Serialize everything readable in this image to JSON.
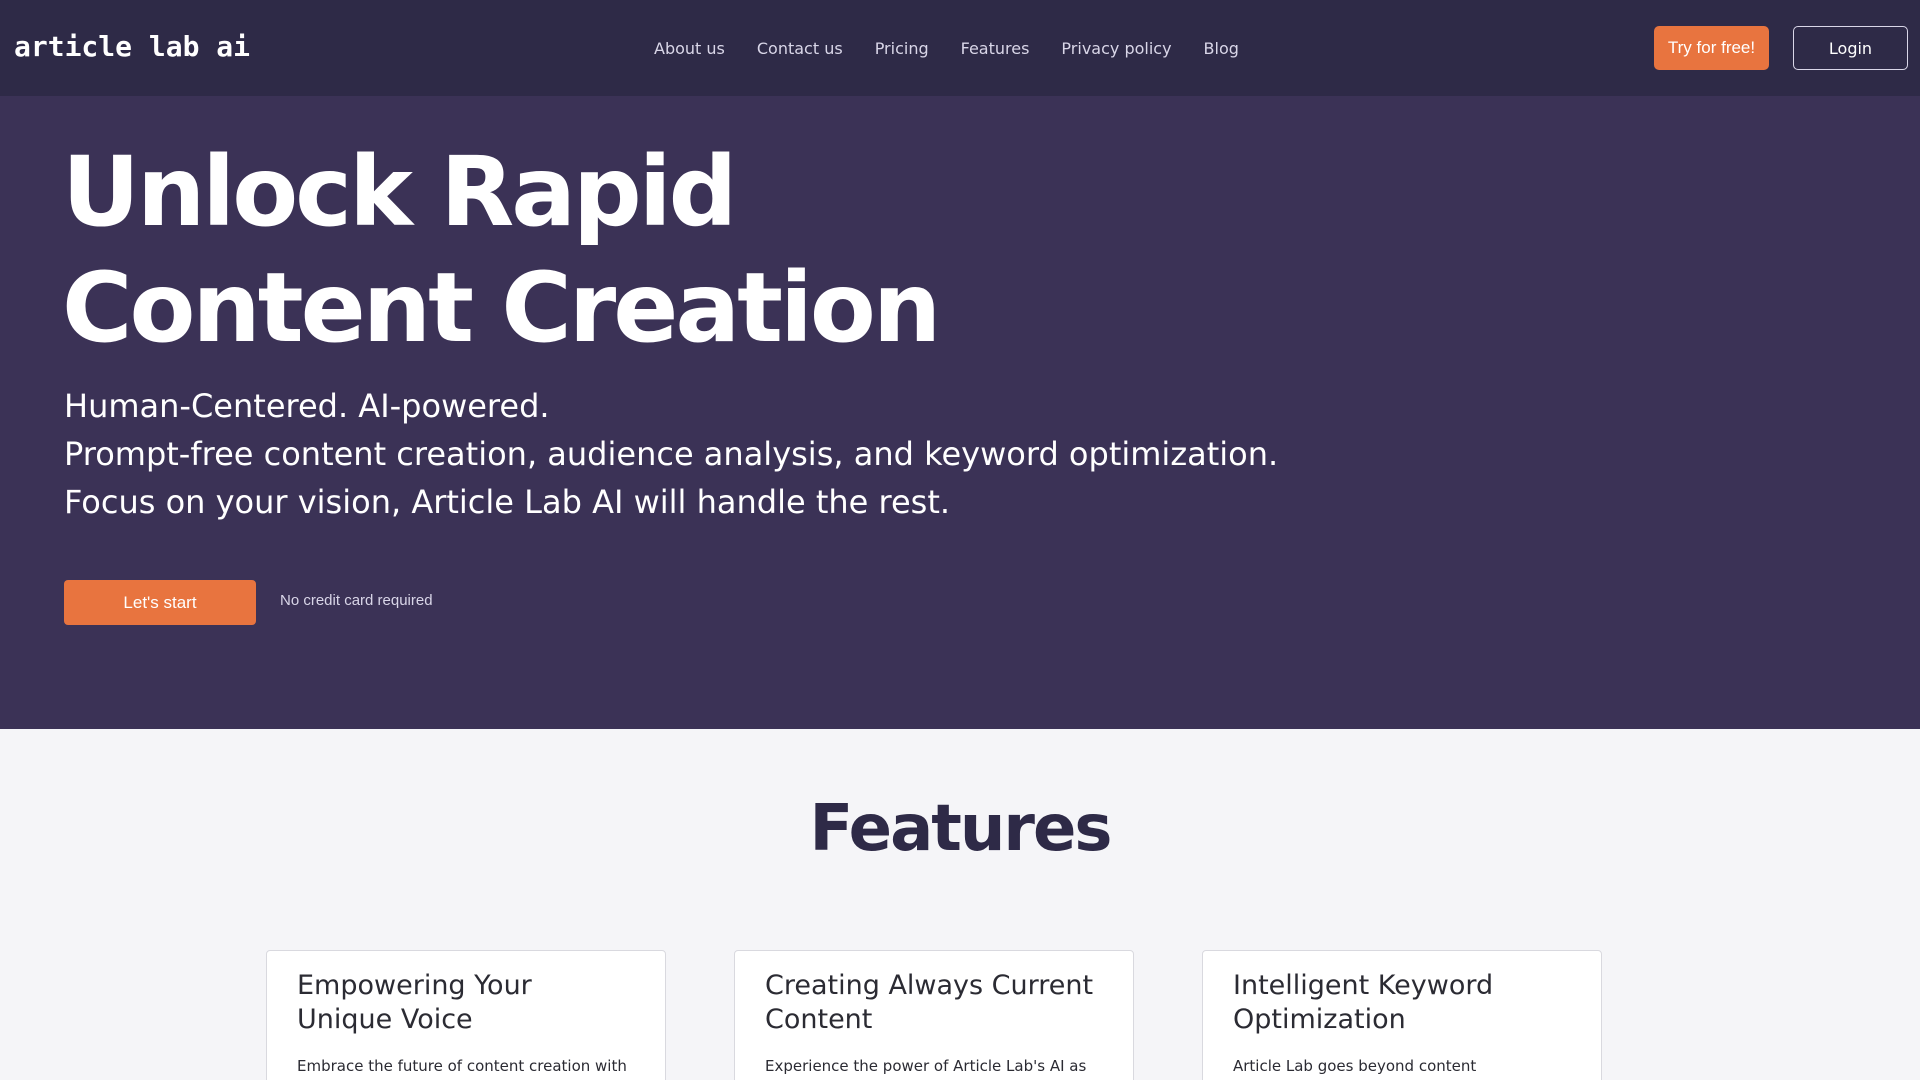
{
  "header": {
    "logo": "article lab ai",
    "nav": [
      "About us",
      "Contact us",
      "Pricing",
      "Features",
      "Privacy policy",
      "Blog"
    ],
    "try_label": "Try for free!",
    "login_label": "Login"
  },
  "hero": {
    "title": "Unlock Rapid Content Creation",
    "subtitle_lines": [
      "Human-Centered. AI-powered.",
      "Prompt-free content creation, audience analysis, and keyword optimization.",
      "Focus on your vision, Article Lab AI will handle the rest."
    ],
    "cta_label": "Let's start",
    "cta_note": "No credit card required"
  },
  "features": {
    "title": "Features",
    "cards": [
      {
        "title": "Empowering Your Unique Voice",
        "text": "Embrace the future of content creation with"
      },
      {
        "title": "Creating Always Current Content",
        "text": "Experience the power of Article Lab's AI as"
      },
      {
        "title": "Intelligent Keyword Optimization",
        "text": "Article Lab goes beyond content"
      }
    ]
  },
  "colors": {
    "nav_bg": "#2e2a47",
    "hero_bg": "#3b3256",
    "accent": "#e8743f",
    "page_bg": "#f5f5f8"
  }
}
